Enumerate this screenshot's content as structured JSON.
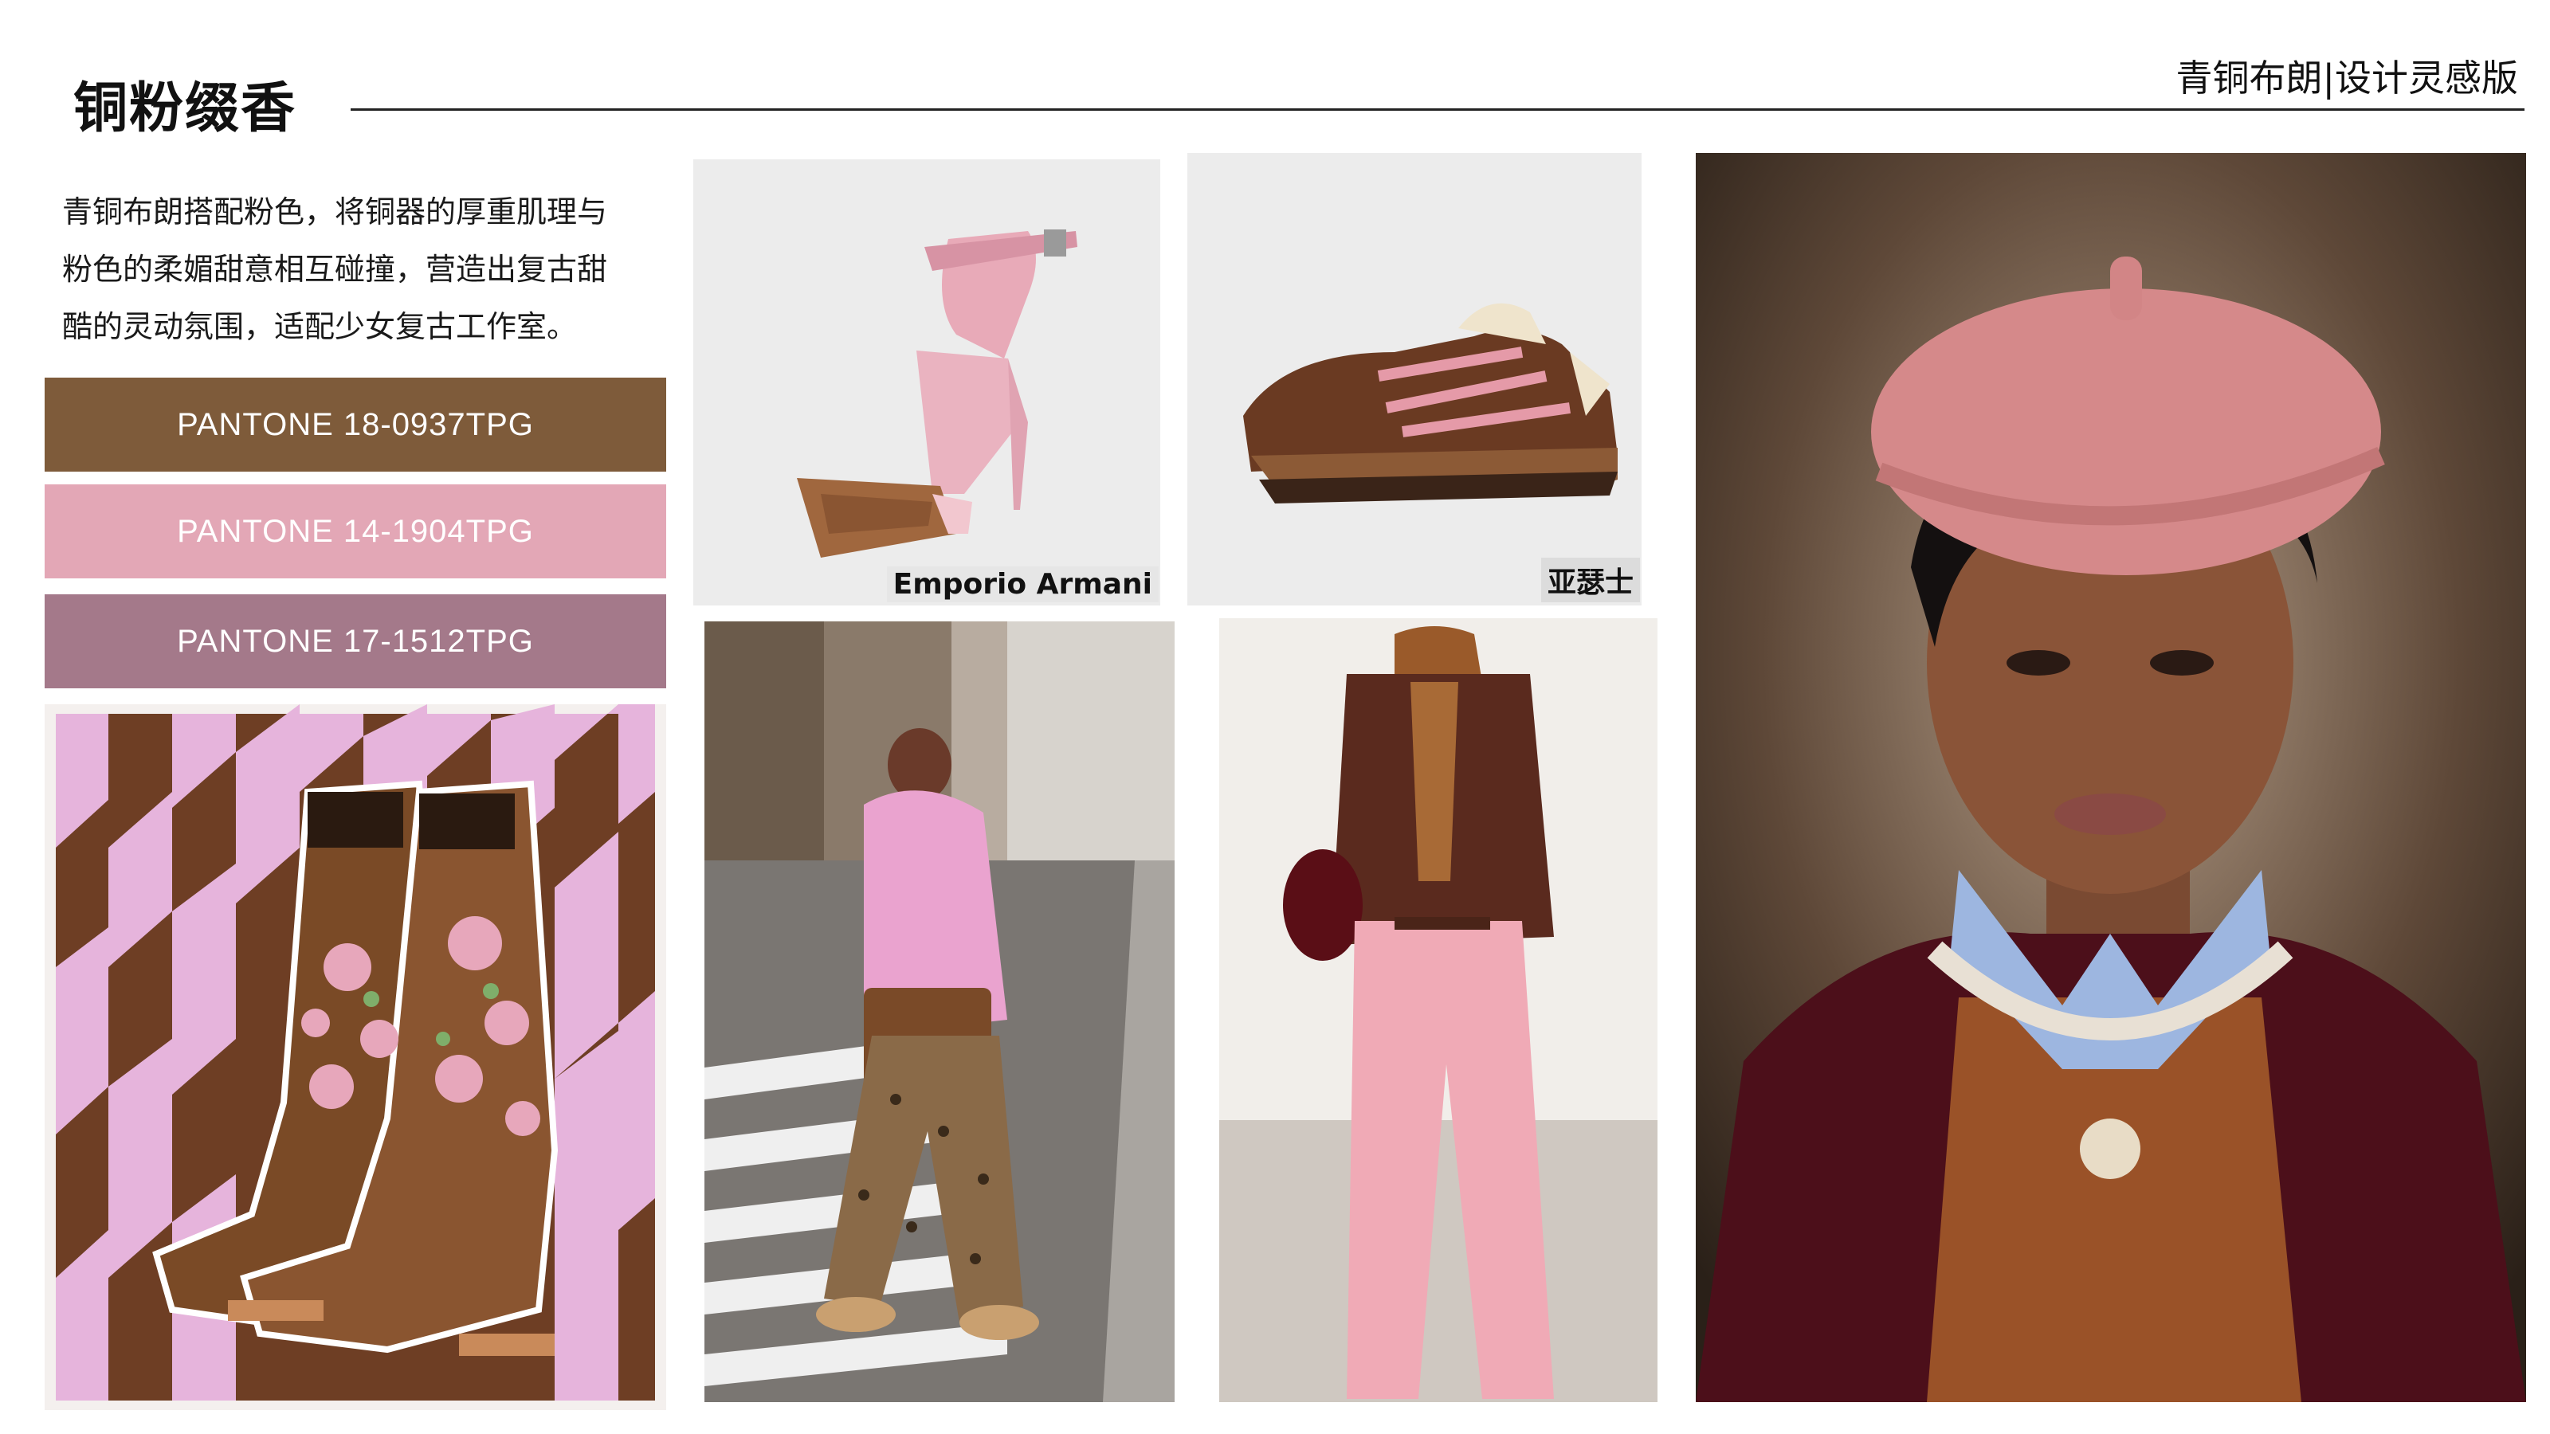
{
  "header": {
    "title": "铜粉缀香",
    "brand": "青铜布朗|设计灵感版"
  },
  "description": {
    "line1": "青铜布朗搭配粉色，将铜器的厚重肌理与",
    "line2": "粉色的柔媚甜意相互碰撞，营造出复古甜",
    "line3": "酷的灵动氛围，适配少女复古工作室。"
  },
  "palette": [
    {
      "label": "PANTONE  18-0937TPG",
      "color": "#7e5b3a"
    },
    {
      "label": "PANTONE  14-1904TPG",
      "color": "#e3a7b6"
    },
    {
      "label": "PANTONE  17-1512TPG",
      "color": "#a4798a"
    }
  ],
  "captions": {
    "sandal": "Emporio Armani",
    "sneaker": "亚瑟士"
  },
  "colors": {
    "brown": "#6b3f25",
    "pink": "#e8b2c4",
    "burgundy": "#4a1018"
  },
  "photos": [
    "cowboy-boots-photo",
    "pink-sandal-photo",
    "sneaker-photo",
    "street-style-photo",
    "blazer-trousers-photo",
    "beret-portrait-photo"
  ]
}
